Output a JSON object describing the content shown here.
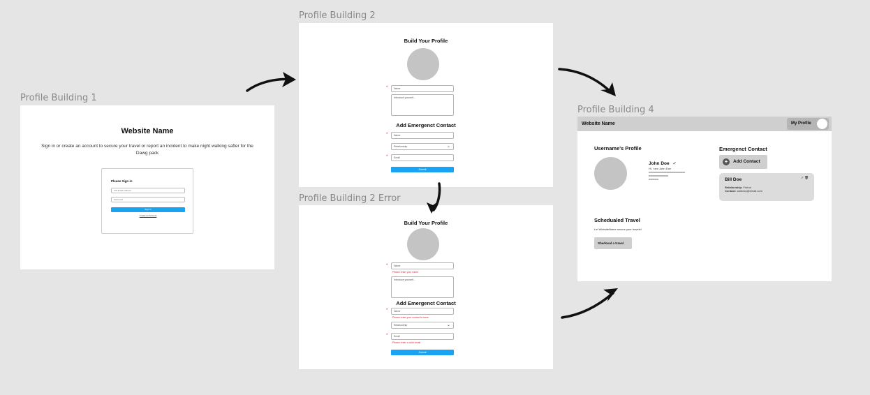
{
  "labels": {
    "frame1": "Profile Building 1",
    "frame2": "Profile Building 2",
    "frame2_error": "Profile Building 2 Error",
    "frame4": "Profile Building 4"
  },
  "frame1": {
    "title": "Website Name",
    "description": "Sign in or create an account to secure your travel or report an incident to make night walking safter for the Dawg pack",
    "signin": {
      "title": "Please Sign in",
      "email_placeholder": "UW Email address",
      "password_placeholder": "Password",
      "button": "Sign in",
      "create_link": "Create an Account"
    }
  },
  "frame2": {
    "title": "Build Your Profile",
    "name_placeholder": "Name",
    "intro_placeholder": "Introduce yourself...",
    "contact_title": "Add Emergenct Contact",
    "contact_name": "Name",
    "relationship": "Relationship",
    "email": "Email",
    "submit": "Submit",
    "required_mark": "*"
  },
  "frame2_error": {
    "title": "Build Your Profile",
    "name_placeholder": "Name",
    "name_error": "Please enter your name",
    "intro_placeholder": "Introduce yourself...",
    "contact_title": "Add Emergenct Contact",
    "contact_name": "Name",
    "contact_error": "Please enter your contact's name",
    "relationship": "Relationship",
    "email": "Email",
    "email_error": "Please enter a valid email",
    "submit": "Submit",
    "required_mark": "*"
  },
  "frame4": {
    "site_name": "Website Name",
    "my_profile": "My Profile",
    "profile_heading": "Username's Profile",
    "user_name": "John Doe",
    "edit_mark": "✓",
    "user_intro": "Hi, I am John Doe",
    "filler_1": "xxxxxxxxxxxxxxxxxxxxxxxxxx",
    "filler_2": "xxxxxxxxxxxxxx",
    "filler_3": "xxxxxxx",
    "emergency_heading": "Emergenct Contact",
    "add_contact": "Add Contact",
    "add_icon": "+",
    "contact": {
      "name": "Bill Doe",
      "relationship_label": "Relationship:",
      "relationship_value": "Friend",
      "contact_label": "Contact:",
      "contact_value": "address@email.com",
      "actions": "✓ 🗑"
    },
    "travel_heading": "Schedualed Travel",
    "travel_text": "Let WebsiteName secure your travels!",
    "travel_button": "Shedoual a travel"
  },
  "colors": {
    "canvas": "#e5e5e5",
    "primary_button": "#1aa3f2",
    "error": "#e0283a",
    "avatar": "#c4c4c4"
  }
}
